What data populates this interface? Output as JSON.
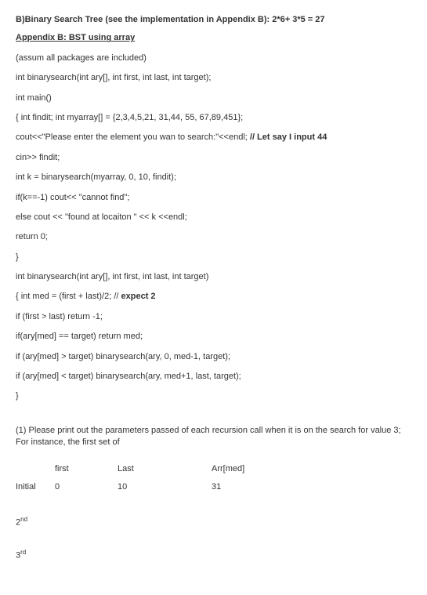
{
  "heading": "B)Binary Search Tree (see the implementation in Appendix B): 2*6+ 3*5 = 27",
  "appendix": "Appendix B: BST using array",
  "code": {
    "l1": "(assum all packages are included)",
    "l2": "int binarysearch(int ary[], int first, int last, int target);",
    "l3": "int main()",
    "l4": "{   int findit;    int myarray[] = {2,3,4,5,21, 31,44, 55, 67,89,451};",
    "l5a": "  cout<<\"Please enter the element you wan to search:\"<<endl;  ",
    "l5b": "// Let say I input 44",
    "l6": "    cin>> findit;",
    "l7": "    int k = binarysearch(myarray, 0, 10, findit);",
    "l8": "         if(k==-1)   cout<< \"cannot find\";",
    "l9": "         else    cout << \"found at locaiton \" << k <<endl;",
    "l10": "     return 0;",
    "l11": "}",
    "l12": "int binarysearch(int ary[], int first, int last, int target)",
    "l13a": "{  int med = (first + last)/2; // ",
    "l13b": "expect 2",
    "l14": "     if (first > last)    return -1;",
    "l15": "     if(ary[med] == target)       return med;",
    "l16": "     if (ary[med] > target)     binarysearch(ary, 0, med-1, target);",
    "l17": "     if (ary[med] < target)      binarysearch(ary, med+1, last, target);",
    "l18": "}"
  },
  "question": "(1) Please print out the parameters passed of each recursion call when it is on the search for value 3; For instance, the first set of",
  "table": {
    "h_first": "first",
    "h_last": "Last",
    "h_arr": "Arr[med]",
    "r_initial_label": "Initial",
    "r_initial_first": "0",
    "r_initial_last": "10",
    "r_initial_arr": "31"
  },
  "row2_base": "2",
  "row2_sup": "nd",
  "row3_base": "3",
  "row3_sup": "rd"
}
